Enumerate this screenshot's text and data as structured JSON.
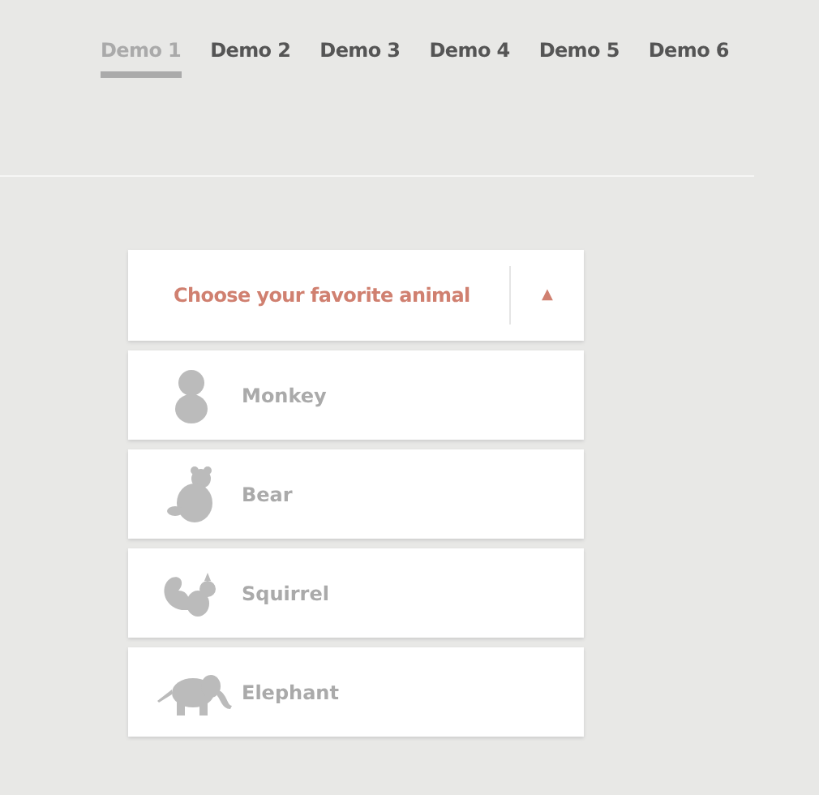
{
  "tabs": [
    {
      "label": "Demo 1",
      "selected": true
    },
    {
      "label": "Demo 2",
      "selected": false
    },
    {
      "label": "Demo 3",
      "selected": false
    },
    {
      "label": "Demo 4",
      "selected": false
    },
    {
      "label": "Demo 5",
      "selected": false
    },
    {
      "label": "Demo 6",
      "selected": false
    }
  ],
  "dropdown": {
    "placeholder": "Choose your favorite animal",
    "arrow": "▲",
    "expanded": true,
    "options": [
      {
        "label": "Monkey"
      },
      {
        "label": "Bear"
      },
      {
        "label": "Squirrel"
      },
      {
        "label": "Elephant"
      }
    ]
  }
}
